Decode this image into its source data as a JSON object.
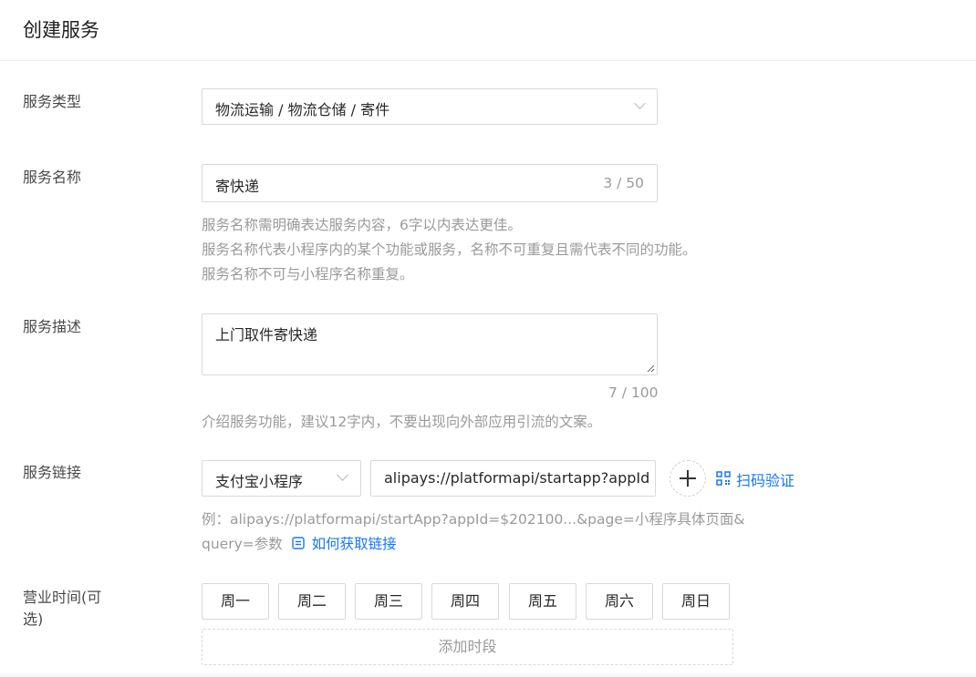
{
  "header": {
    "title": "创建服务"
  },
  "service_type": {
    "label": "服务类型",
    "value": "物流运输 / 物流仓储 / 寄件",
    "icon": "chevron-down-icon"
  },
  "service_name": {
    "label": "服务名称",
    "value": "寄快递",
    "counter": "3 / 50",
    "hints": [
      "服务名称需明确表达服务内容，6字以内表达更佳。",
      "服务名称代表小程序内的某个功能或服务，名称不可重复且需代表不同的功能。",
      "服务名称不可与小程序名称重复。"
    ]
  },
  "service_desc": {
    "label": "服务描述",
    "value": "上门取件寄快递",
    "counter": "7 / 100",
    "hint": "介绍服务功能，建议12字内，不要出现向外部应用引流的文案。"
  },
  "service_link": {
    "label": "服务链接",
    "link_type": "支付宝小程序",
    "url": "alipays://platformapi/startapp?appId",
    "scan_label": "扫码验证",
    "example_line1": "例：alipays://platformapi/startApp?appId=$202100...&page=小程序具体页面&",
    "example_line2": "query=参数",
    "howto_label": "如何获取链接"
  },
  "business_hours": {
    "label": "营业时间(可选)",
    "days": [
      "周一",
      "周二",
      "周三",
      "周四",
      "周五",
      "周六",
      "周日"
    ],
    "add_slot_label": "添加时段"
  },
  "colors": {
    "link": "#1677ff",
    "border": "#d9d9d9",
    "hint": "#9a9a9a"
  }
}
